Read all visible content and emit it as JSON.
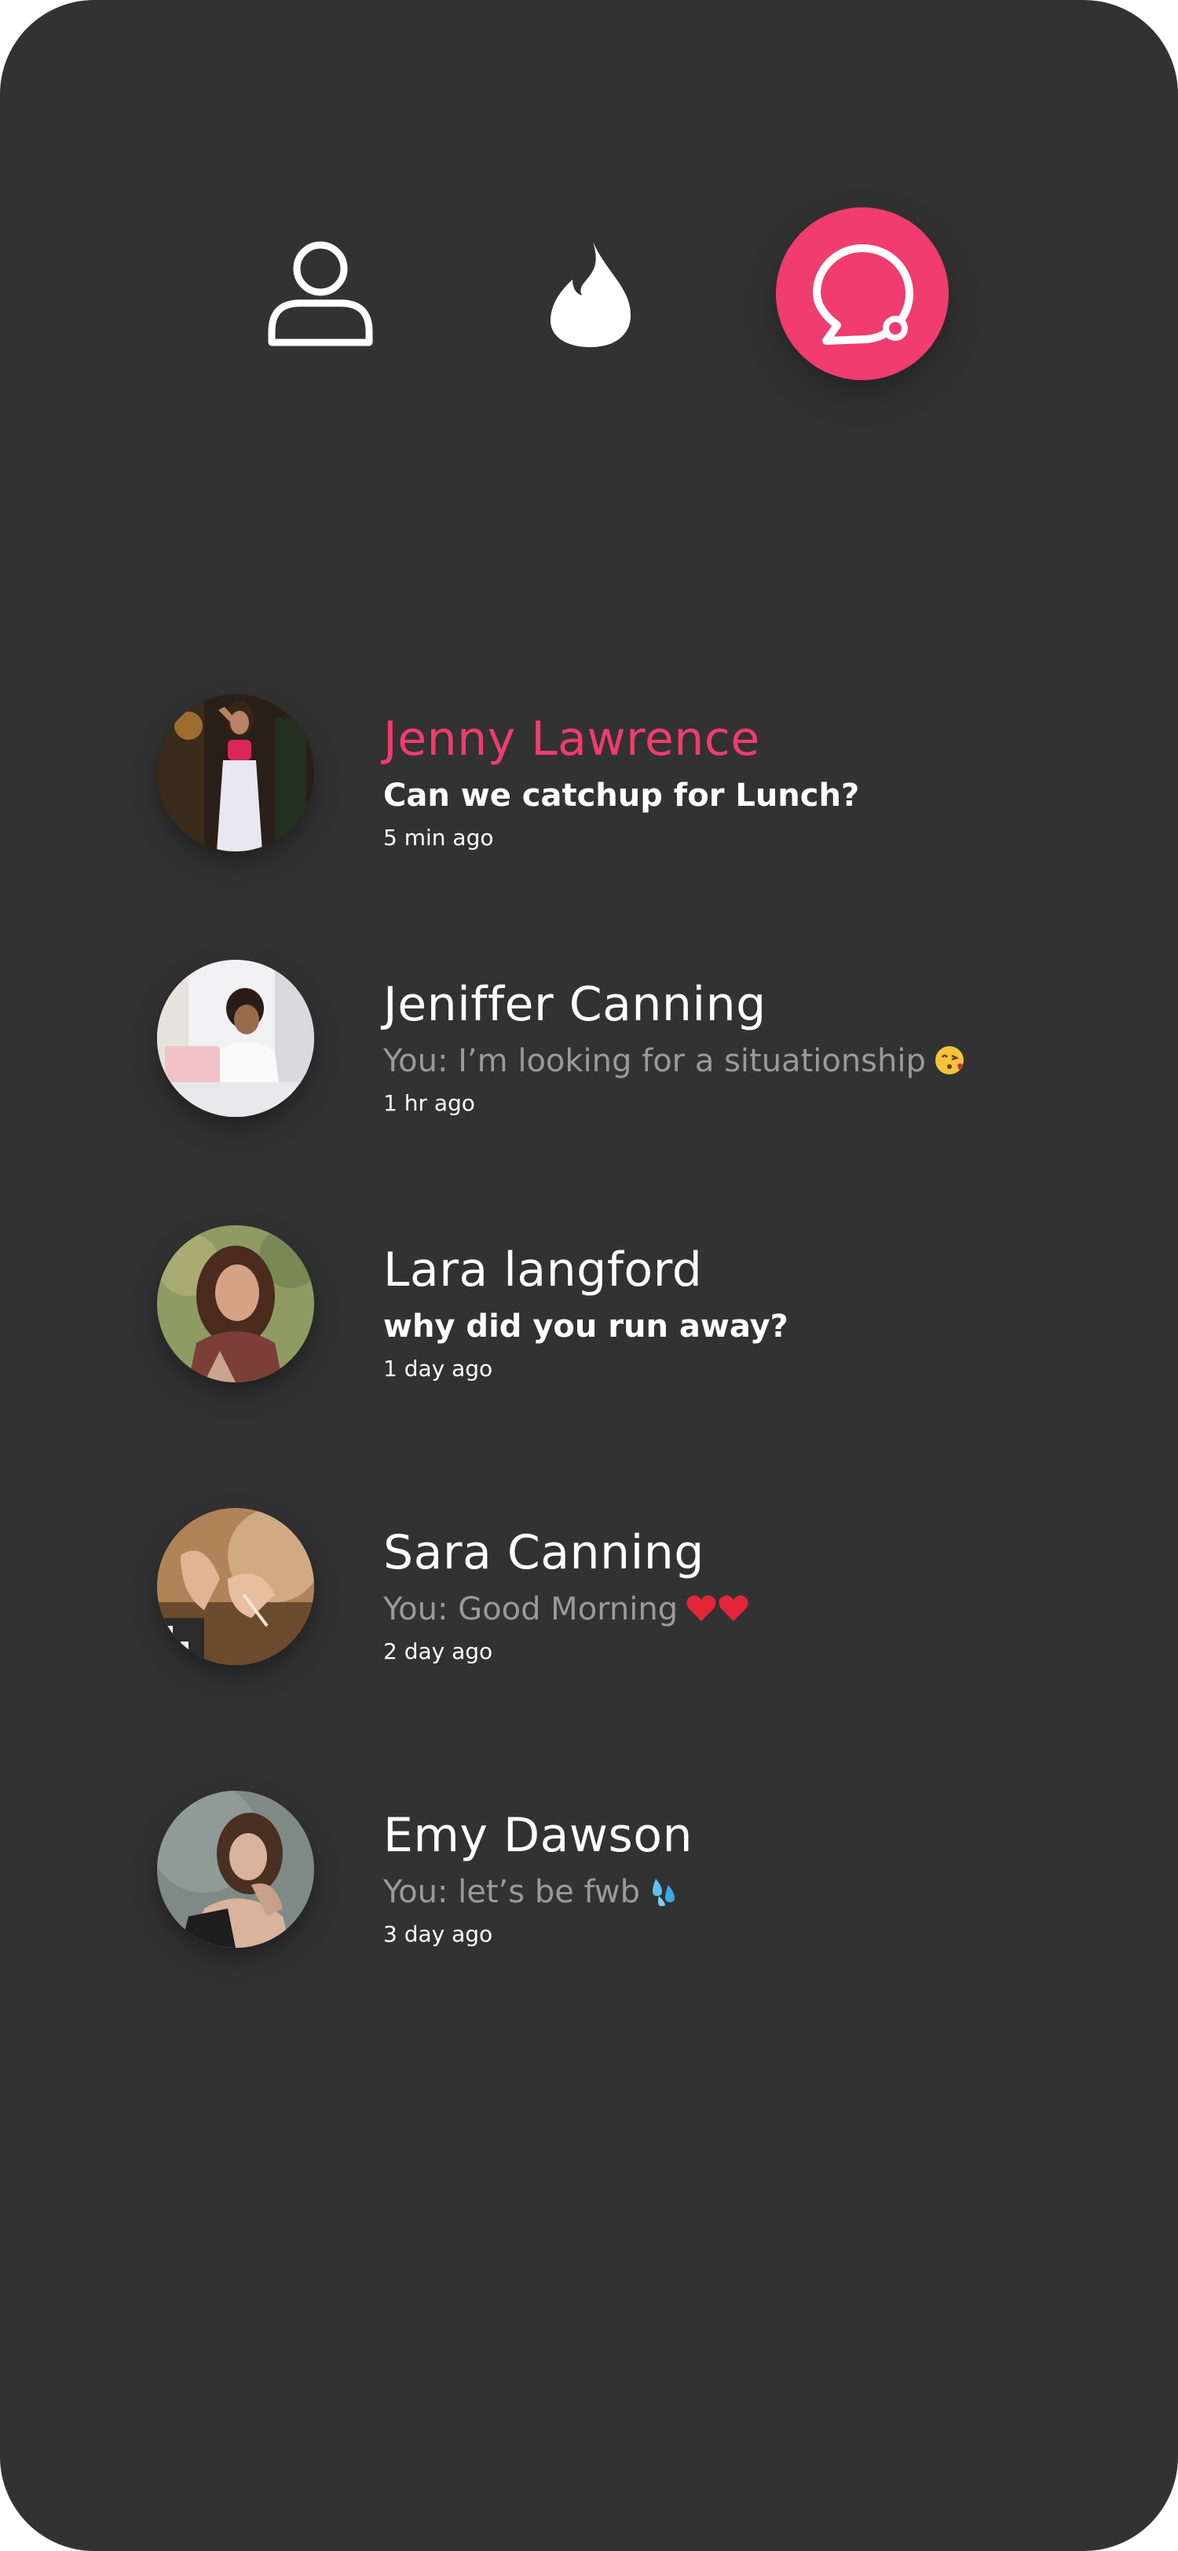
{
  "nav": {
    "items": [
      {
        "icon": "profile-icon",
        "active": false
      },
      {
        "icon": "flame-icon",
        "active": false
      },
      {
        "icon": "chat-bubble-icon",
        "active": true
      }
    ],
    "accent_color": "#f03c6e",
    "background_color": "#323232"
  },
  "chats": [
    {
      "name": "Jenny Lawrence",
      "message": "Can we catchup for Lunch?",
      "time": "5 min ago",
      "unread": true,
      "emoji": ""
    },
    {
      "name": "Jeniffer Canning",
      "message": "You: I’m looking for a situationship",
      "time": "1 hr ago",
      "unread": false,
      "emoji": "kiss-emoji"
    },
    {
      "name": "Lara langford",
      "message": "why did you run away?",
      "time": "1 day ago",
      "unread": true,
      "emoji": ""
    },
    {
      "name": "Sara Canning",
      "message": "You: Good Morning",
      "time": "2 day ago",
      "unread": false,
      "emoji": "two-hearts-emoji"
    },
    {
      "name": "Emy Dawson",
      "message": "You: let’s be fwb",
      "time": "3 day ago",
      "unread": false,
      "emoji": "sweat-droplets-emoji"
    }
  ]
}
